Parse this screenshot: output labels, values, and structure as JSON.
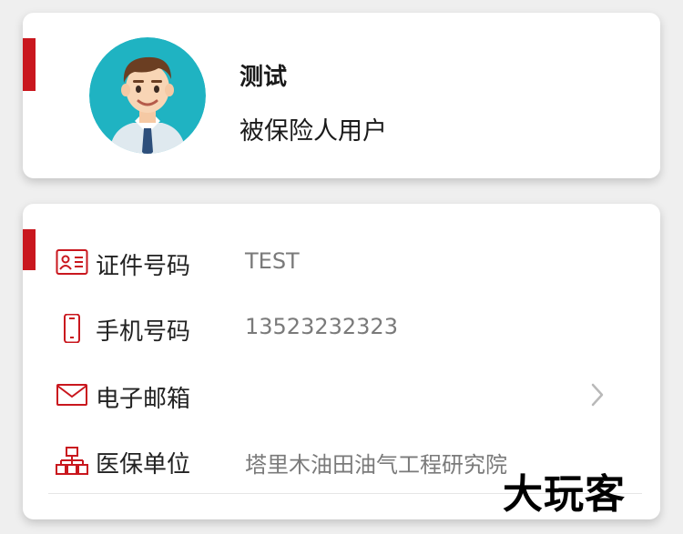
{
  "profile": {
    "name": "测试",
    "role": "被保险人用户",
    "avatar_icon": "user-avatar"
  },
  "info": {
    "rows": [
      {
        "icon": "id-card-icon",
        "label": "证件号码",
        "value": "TEST"
      },
      {
        "icon": "phone-icon",
        "label": "手机号码",
        "value": "13523232323"
      },
      {
        "icon": "mail-icon",
        "label": "电子邮箱",
        "value": ""
      },
      {
        "icon": "org-chart-icon",
        "label": "医保单位",
        "value": "塔里木油田油气工程研究院"
      }
    ]
  },
  "watermark": "大玩客",
  "colors": {
    "accent": "#c9171e",
    "avatar_bg": "#1fb3c2"
  }
}
